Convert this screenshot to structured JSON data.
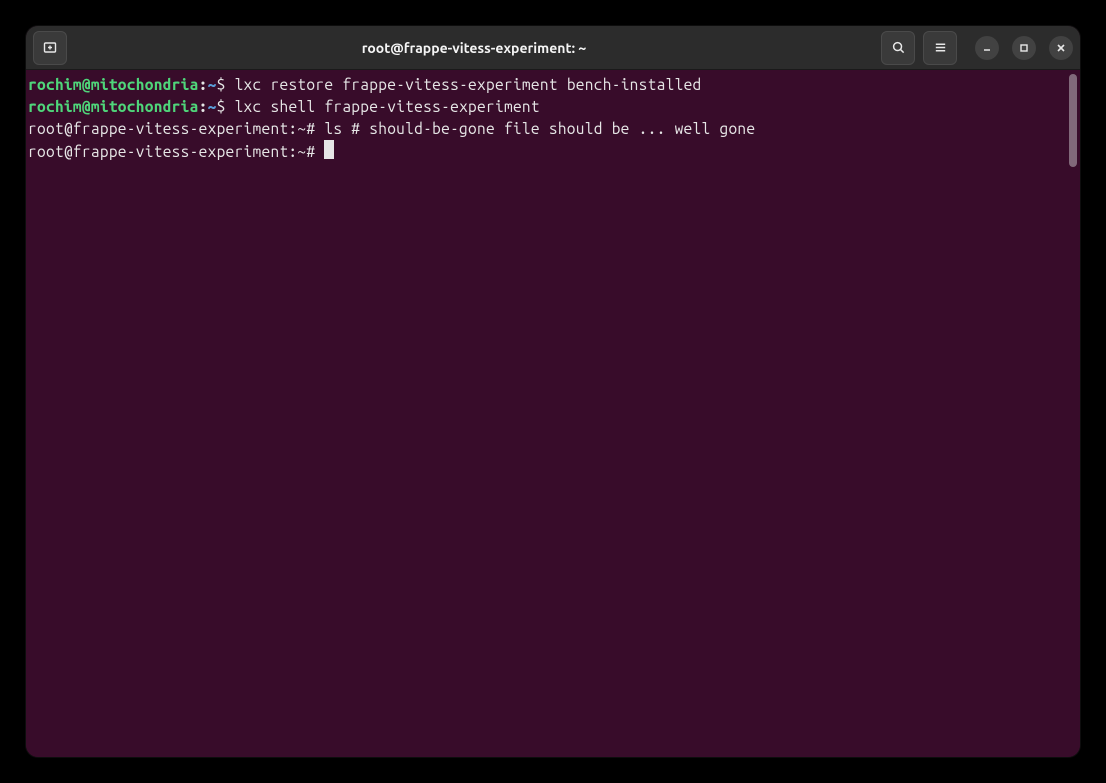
{
  "titlebar": {
    "title": "root@frappe-vitess-experiment: ~"
  },
  "icons": {
    "newtab": "new-tab-icon",
    "search": "search-icon",
    "menu": "hamburger-icon",
    "minimize": "minimize-icon",
    "maximize": "maximize-icon",
    "close": "close-icon"
  },
  "lines": [
    {
      "type": "local",
      "user_host": "rochim@mitochondria",
      "path": "~",
      "symbol": "$",
      "command": "lxc restore frappe-vitess-experiment bench-installed"
    },
    {
      "type": "local",
      "user_host": "rochim@mitochondria",
      "path": "~",
      "symbol": "$",
      "command": "lxc shell frappe-vitess-experiment"
    },
    {
      "type": "root",
      "prompt": "root@frappe-vitess-experiment:~#",
      "command": "ls # should-be-gone file should be ... well gone"
    },
    {
      "type": "root-cursor",
      "prompt": "root@frappe-vitess-experiment:~#",
      "command": ""
    }
  ]
}
